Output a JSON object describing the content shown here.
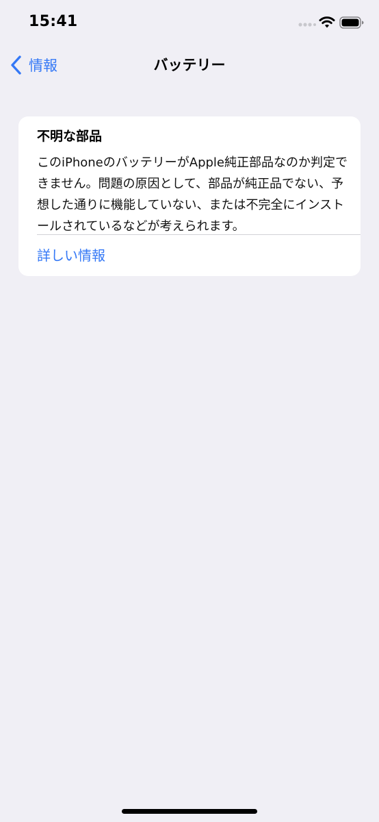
{
  "status_bar": {
    "time": "15:41",
    "icons": [
      "signal-dots-icon",
      "wifi-icon",
      "battery-icon"
    ]
  },
  "nav": {
    "back_label": "情報",
    "title": "バッテリー"
  },
  "card": {
    "title": "不明な部品",
    "body": "このiPhoneのバッテリーがApple純正部品なのか判定できません。問題の原因として、部品が純正品でない、予想した通りに機能していない、または不完全にインストールされているなどが考えられます。",
    "link_label": "詳しい情報"
  },
  "colors": {
    "background": "#f0eff5",
    "accent": "#3478f6",
    "card": "#ffffff",
    "divider": "#d1d1d6"
  }
}
